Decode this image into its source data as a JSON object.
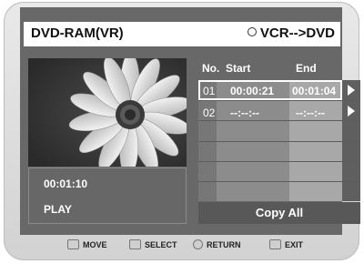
{
  "header": {
    "title": "DVD-RAM(VR)",
    "mode": "VCR-->DVD"
  },
  "info": {
    "time": "00:01:10",
    "status": "PLAY"
  },
  "table": {
    "columns": {
      "no": "No.",
      "start": "Start",
      "end": "End"
    },
    "rows": [
      {
        "no": "01",
        "start": "00:00:21",
        "end": "00:01:04",
        "selected": true
      },
      {
        "no": "02",
        "start": "--:--:--",
        "end": "--:--:--",
        "selected": false
      }
    ],
    "copy_all_label": "Copy All"
  },
  "footer": {
    "move": "MOVE",
    "select": "SELECT",
    "return": "RETURN",
    "exit": "EXIT"
  },
  "colors": {
    "background": "#686868",
    "start_column": "#8c8c8c",
    "end_column": "#a8a8a8",
    "highlight": "#ffffff"
  }
}
